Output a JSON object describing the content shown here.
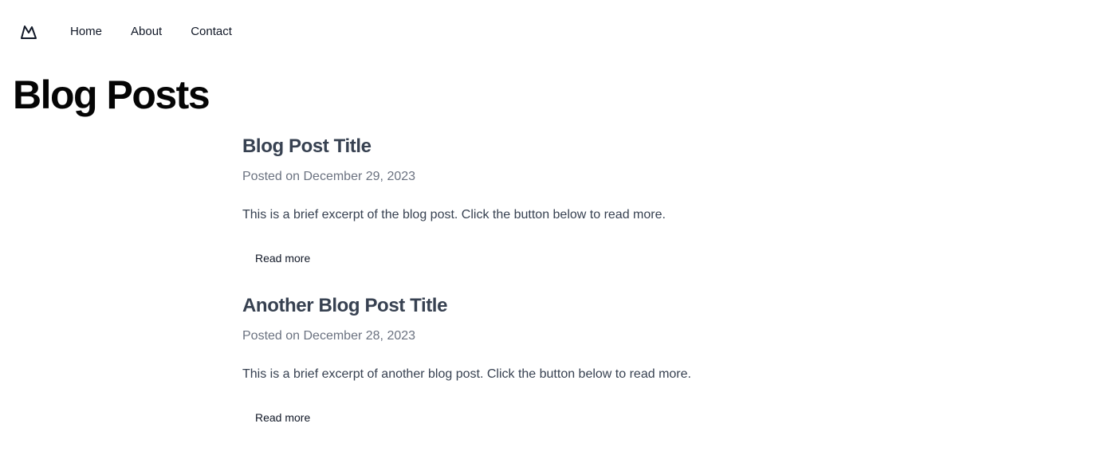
{
  "nav": {
    "logo_icon": "mountain-logo-icon",
    "links": [
      {
        "label": "Home"
      },
      {
        "label": "About"
      },
      {
        "label": "Contact"
      }
    ]
  },
  "page": {
    "title": "Blog Posts"
  },
  "posts": [
    {
      "title": "Blog Post Title",
      "date": "Posted on December 29, 2023",
      "excerpt": "This is a brief excerpt of the blog post. Click the button below to read more.",
      "button_label": "Read more"
    },
    {
      "title": "Another Blog Post Title",
      "date": "Posted on December 28, 2023",
      "excerpt": "This is a brief excerpt of another blog post. Click the button below to read more.",
      "button_label": "Read more"
    }
  ],
  "colors": {
    "title": "#050505",
    "post_title": "#374151",
    "meta": "#6b7280",
    "text": "#374151"
  }
}
